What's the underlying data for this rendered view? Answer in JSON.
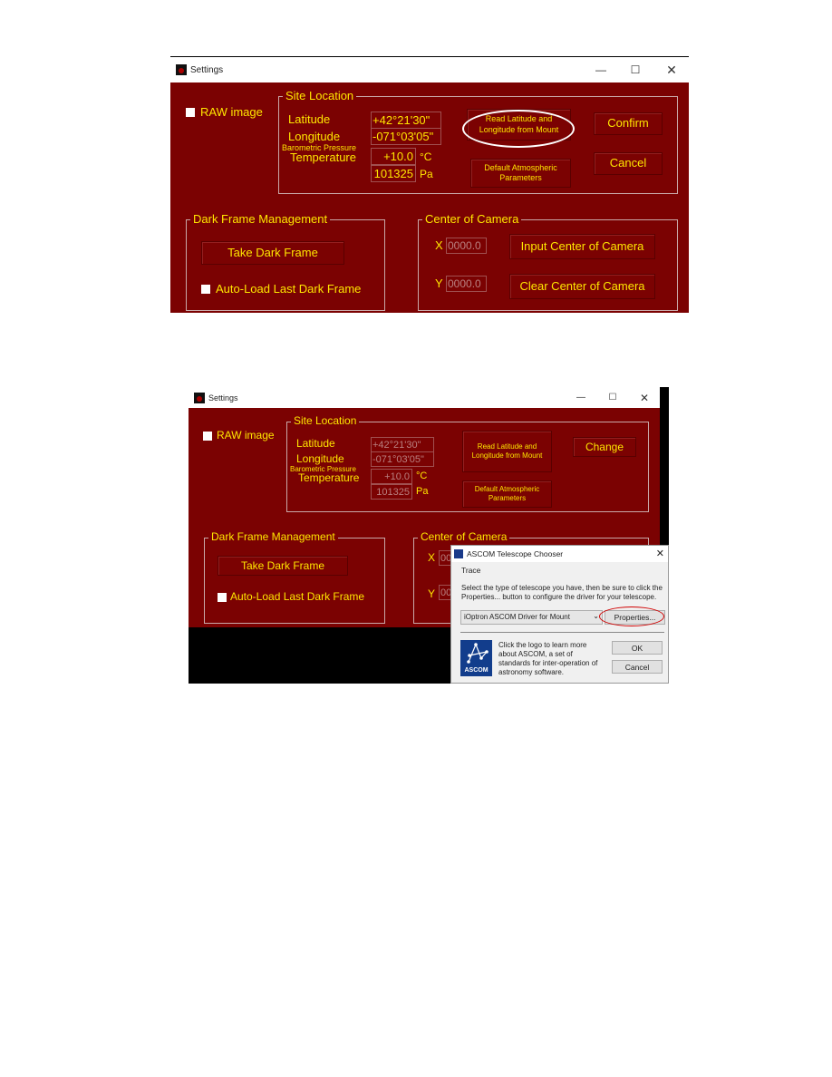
{
  "screenshot1": {
    "window_title": "Settings",
    "raw_image": "RAW image",
    "site_location": {
      "title": "Site Location",
      "latitude_label": "Latitude",
      "longitude_label": "Longitude",
      "pressure_label": "Barometric Pressure",
      "temperature_label": "Temperature",
      "latitude": "+42°21'30\"",
      "longitude": "-071°03'05\"",
      "temperature": "+10.0",
      "temp_unit": "°C",
      "pressure": "101325",
      "pressure_unit": "Pa"
    },
    "read_button": "Read Latitude and Longitude from Mount",
    "default_button": "Default Atmospheric Parameters",
    "confirm": "Confirm",
    "cancel": "Cancel",
    "dark_frame": {
      "title": "Dark Frame Management",
      "take": "Take Dark Frame",
      "autoload": "Auto-Load Last Dark Frame"
    },
    "center": {
      "title": "Center of Camera",
      "x_label": "X",
      "y_label": "Y",
      "x_value": "0000.0",
      "y_value": "0000.0",
      "input": "Input Center of Camera",
      "clear": "Clear Center of Camera"
    },
    "highlight_color": "#ffffff"
  },
  "screenshot2": {
    "window_title": "Settings",
    "raw_image": "RAW image",
    "site_location": {
      "title": "Site Location",
      "latitude_label": "Latitude",
      "longitude_label": "Longitude",
      "pressure_label": "Barometric Pressure",
      "temperature_label": "Temperature",
      "latitude": "+42°21'30\"",
      "longitude": "-071°03'05\"",
      "temperature": "+10.0",
      "temp_unit": "°C",
      "pressure": "101325",
      "pressure_unit": "Pa"
    },
    "read_button": "Read Latitude and Longitude from Mount",
    "default_button": "Default Atmospheric Parameters",
    "change": "Change",
    "dark_frame": {
      "title": "Dark Frame Management",
      "take": "Take Dark Frame",
      "autoload": "Auto-Load Last Dark Frame"
    },
    "center": {
      "title": "Center of Camera",
      "x_label": "X",
      "y_label": "Y",
      "x_partial": "00",
      "y_partial": "00"
    },
    "ascom": {
      "title": "ASCOM Telescope Chooser",
      "trace": "Trace",
      "instructions": "Select the type of telescope you have, then be sure to click the Properties... button to configure the driver for your telescope.",
      "driver": "iOptron ASCOM Driver for Mount",
      "properties": "Properties...",
      "logo_text": "ASCOM",
      "info": "Click the logo to learn more about ASCOM, a set of standards for inter-operation of astronomy software.",
      "ok": "OK",
      "cancel": "Cancel"
    },
    "highlight_color": "#d00000"
  },
  "colors": {
    "background": "#7b0202",
    "text": "#ffe600"
  }
}
